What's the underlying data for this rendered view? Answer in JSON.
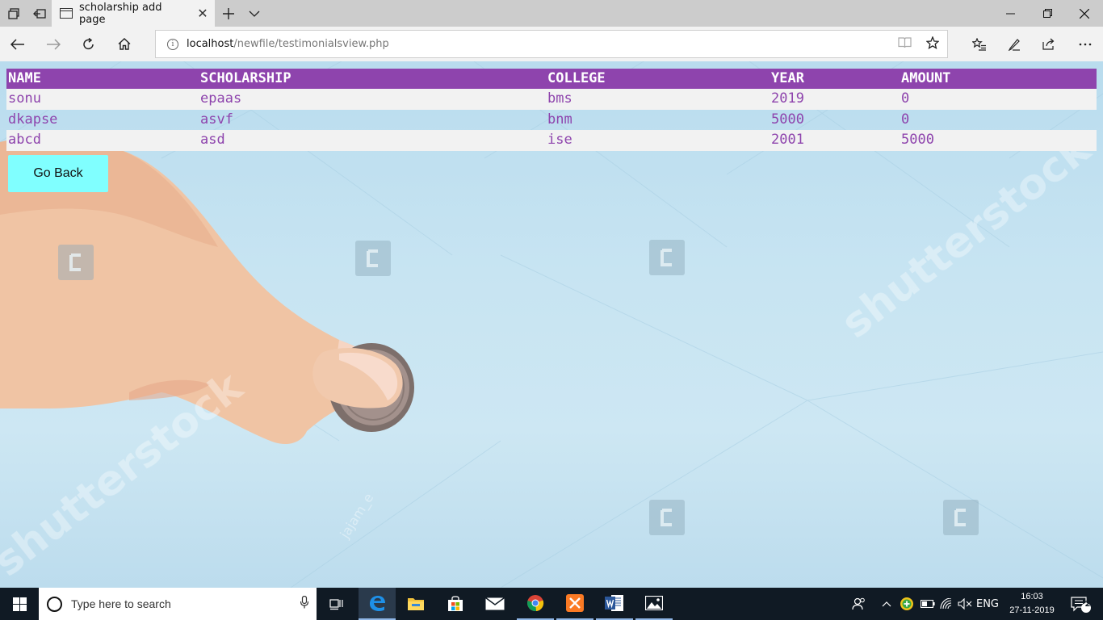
{
  "browser": {
    "tab_title": "scholarship add page",
    "url_host": "localhost",
    "url_path": "/newfile/testimonialsview.php"
  },
  "table": {
    "headers": [
      "NAME",
      "SCHOLARSHIP",
      "COLLEGE",
      "YEAR",
      "AMOUNT"
    ],
    "rows": [
      [
        "sonu",
        "epaas",
        "bms",
        "2019",
        "0"
      ],
      [
        "dkapse",
        "asvf",
        "bnm",
        "5000",
        "0"
      ],
      [
        "abcd",
        "asd",
        "ise",
        "2001",
        "5000"
      ]
    ]
  },
  "page": {
    "go_back_label": "Go Back"
  },
  "watermarks": {
    "brand": "shutterstock",
    "author": "jajam_e"
  },
  "taskbar": {
    "search_placeholder": "Type here to search",
    "language": "ENG",
    "time": "16:03",
    "date": "27-11-2019",
    "notification_count": "2"
  },
  "colors": {
    "table_header_bg": "#8e44ad",
    "table_text": "#8e44ad",
    "button_bg": "#80ffff"
  }
}
